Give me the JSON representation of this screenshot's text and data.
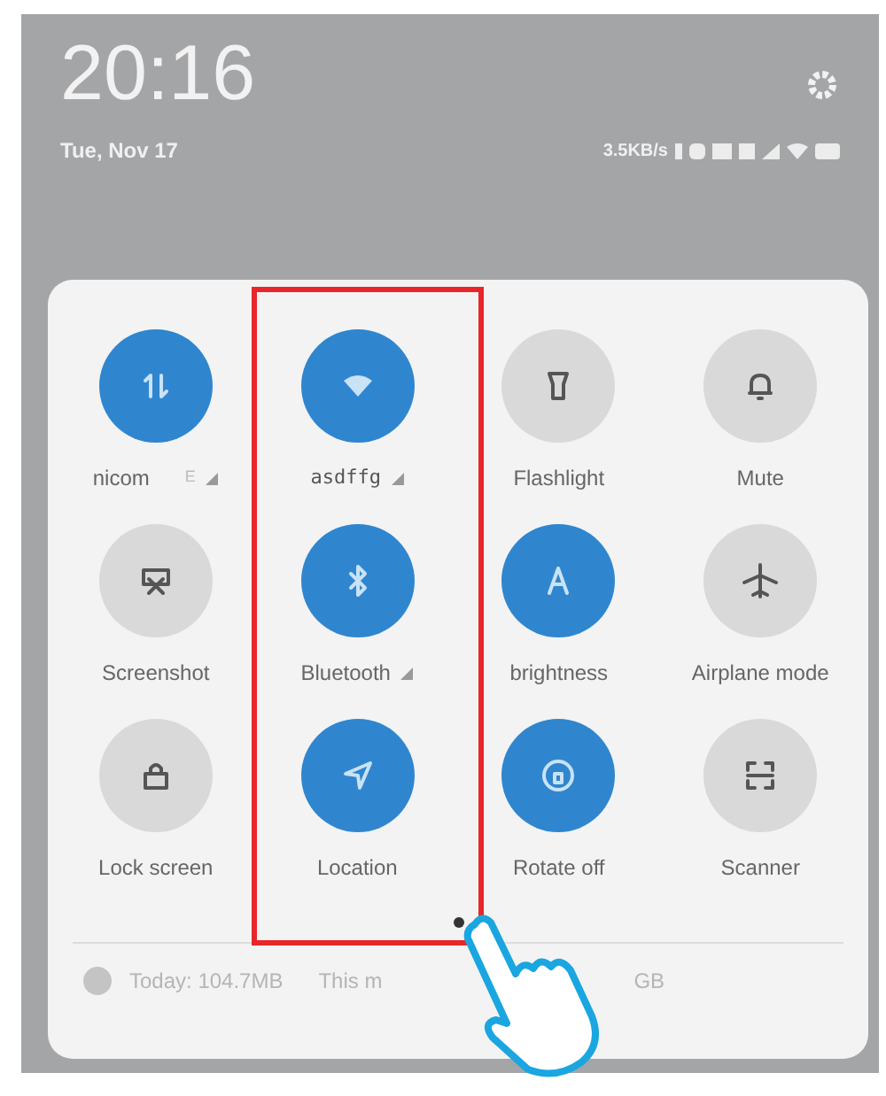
{
  "header": {
    "time": "20:16",
    "date": "Tue, Nov 17",
    "network_speed": "3.5KB/s"
  },
  "tiles": [
    {
      "label": "nicom",
      "on": true,
      "signal": true,
      "network_type": "E"
    },
    {
      "label": "asdffg",
      "on": true,
      "signal": true
    },
    {
      "label": "Flashlight",
      "on": false,
      "signal": false
    },
    {
      "label": "Mute",
      "on": false,
      "signal": false
    },
    {
      "label": "Screenshot",
      "on": false,
      "signal": false
    },
    {
      "label": "Bluetooth",
      "on": true,
      "signal": true
    },
    {
      "label": "brightness",
      "on": true,
      "signal": false
    },
    {
      "label": "Airplane mode",
      "on": false,
      "signal": false
    },
    {
      "label": "Lock screen",
      "on": false,
      "signal": false
    },
    {
      "label": "Location",
      "on": true,
      "signal": false
    },
    {
      "label": "Rotate off",
      "on": true,
      "signal": false
    },
    {
      "label": "Scanner",
      "on": false,
      "signal": false
    }
  ],
  "footer": {
    "today": "Today: 104.7MB",
    "month_start": "This m",
    "month_end": "GB"
  }
}
